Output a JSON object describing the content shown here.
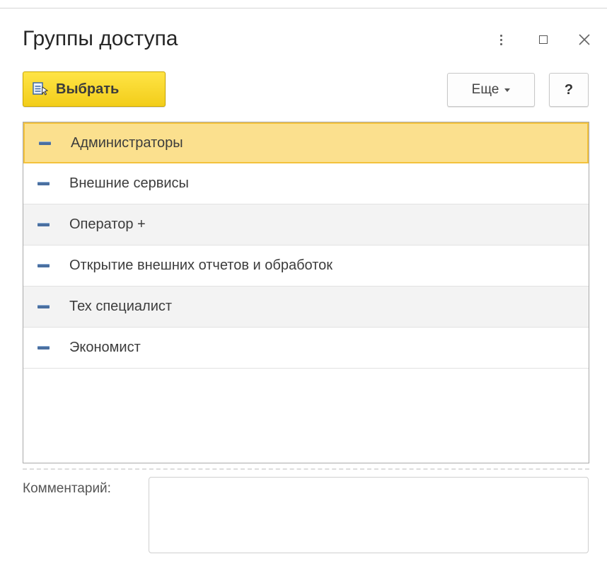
{
  "window": {
    "title": "Группы доступа",
    "controls": [
      "more-icon",
      "maximize-icon",
      "close-icon"
    ]
  },
  "toolbar": {
    "select_label": "Выбрать",
    "more_label": "Еще",
    "help_label": "?"
  },
  "list": {
    "items": [
      {
        "label": "Администраторы",
        "selected": true
      },
      {
        "label": "Внешние сервисы",
        "selected": false
      },
      {
        "label": "Оператор +",
        "selected": false
      },
      {
        "label": "Открытие внешних отчетов и обработок",
        "selected": false
      },
      {
        "label": "Тех специалист",
        "selected": false
      },
      {
        "label": "Экономист",
        "selected": false
      }
    ]
  },
  "comment": {
    "label": "Комментарий:",
    "value": ""
  },
  "colors": {
    "accent_button": "#f5d21f",
    "selected_row": "#fbe08e",
    "item_icon": "#4a6fa0"
  }
}
